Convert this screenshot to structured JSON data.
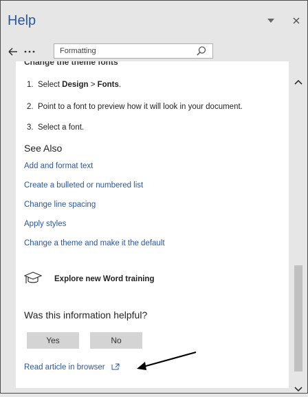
{
  "pane": {
    "title": "Help",
    "menu_icon": "chevron-down-icon",
    "close_label": "×"
  },
  "nav": {
    "back_icon": "back-arrow-icon",
    "more_label": "···",
    "search_value": "Formatting",
    "search_icon": "search-icon"
  },
  "article": {
    "cut_heading": "Change the theme fonts",
    "steps": [
      {
        "num": "1.",
        "pre": "Select ",
        "b1": "Design",
        "mid": " > ",
        "b2": "Fonts",
        "post": "."
      },
      {
        "num": "2.",
        "text": "Point to a font to preview how it will look in your document."
      },
      {
        "num": "3.",
        "text": "Select a font."
      }
    ],
    "see_also": "See Also",
    "links": [
      "Add and format text",
      "Create a bulleted or numbered list",
      "Change line spacing",
      "Apply styles",
      "Change a theme and make it the default"
    ],
    "training": {
      "icon": "graduation-cap-icon",
      "label": "Explore new Word training"
    },
    "helpful_question": "Was this information helpful?",
    "yes_label": "Yes",
    "no_label": "No",
    "read_link": "Read article in browser",
    "read_link_icon": "external-link-icon"
  },
  "colors": {
    "accent": "#2b579a",
    "pane_bg": "#e6e6e6",
    "content_bg": "#ffffff",
    "button_bg": "#d4d4d4"
  }
}
